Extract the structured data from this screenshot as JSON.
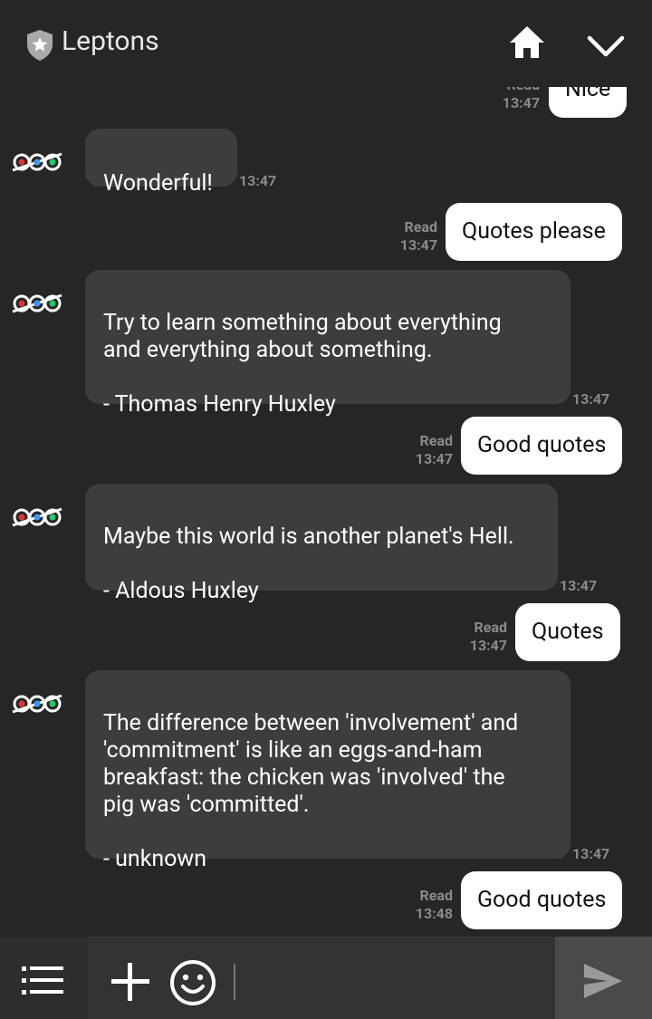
{
  "header": {
    "title": "Leptons"
  },
  "messages": [
    {
      "dir": "out",
      "text": "Nice",
      "status": "Read",
      "time": "13:47"
    },
    {
      "dir": "in",
      "text": "Wonderful!",
      "time": "13:47"
    },
    {
      "dir": "out",
      "text": "Quotes please",
      "status": "Read",
      "time": "13:47"
    },
    {
      "dir": "in",
      "text": "Try to learn something about everything\nand everything about something.\n\n- Thomas Henry Huxley",
      "time": "13:47"
    },
    {
      "dir": "out",
      "text": "Good quotes",
      "status": "Read",
      "time": "13:47"
    },
    {
      "dir": "in",
      "text": "Maybe this world is another planet's Hell.\n\n- Aldous Huxley",
      "time": "13:47"
    },
    {
      "dir": "out",
      "text": "Quotes",
      "status": "Read",
      "time": "13:47"
    },
    {
      "dir": "in",
      "text": "The difference between 'involvement' and\n'commitment' is like an eggs-and-ham\nbreakfast: the chicken was 'involved' the\npig was 'committed'.\n\n- unknown",
      "time": "13:47"
    },
    {
      "dir": "out",
      "text": "Good quotes",
      "status": "Read",
      "time": "13:48"
    }
  ],
  "composer": {
    "value": "",
    "placeholder": ""
  },
  "icons": {
    "shield": "shield-star-icon",
    "home": "home-icon",
    "down": "chevron-down-icon",
    "menu": "list-icon",
    "plus": "plus-icon",
    "emoji": "smiley-icon",
    "send": "send-icon",
    "avatar": "bot-avatar-icon"
  }
}
